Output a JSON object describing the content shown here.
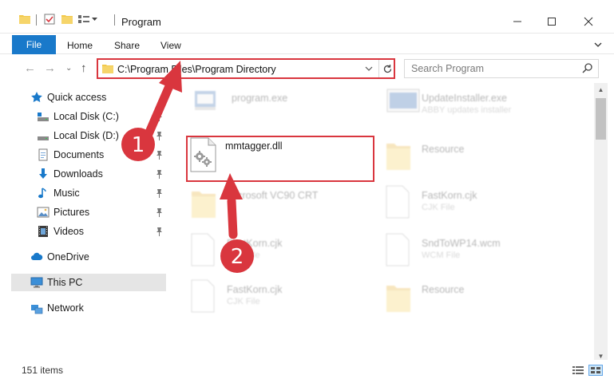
{
  "window": {
    "title": "Program",
    "minimize_icon": "minimize-icon",
    "maximize_icon": "maximize-icon",
    "close_icon": "close-icon"
  },
  "ribbon": {
    "file": "File",
    "home": "Home",
    "share": "Share",
    "view": "View"
  },
  "address": {
    "path": "C:\\Program Files\\Program Directory"
  },
  "search": {
    "placeholder": "Search Program"
  },
  "sidebar": {
    "items": [
      {
        "label": "Quick access",
        "icon": "star-icon"
      },
      {
        "label": "Local Disk (C:)",
        "icon": "drive-icon"
      },
      {
        "label": "Local Disk (D:)",
        "icon": "drive-icon"
      },
      {
        "label": "Documents",
        "icon": "documents-icon"
      },
      {
        "label": "Downloads",
        "icon": "download-icon"
      },
      {
        "label": "Music",
        "icon": "music-icon"
      },
      {
        "label": "Pictures",
        "icon": "pictures-icon"
      },
      {
        "label": "Videos",
        "icon": "videos-icon"
      },
      {
        "label": "OneDrive",
        "icon": "cloud-icon"
      },
      {
        "label": "This PC",
        "icon": "computer-icon"
      },
      {
        "label": "Network",
        "icon": "network-icon"
      }
    ]
  },
  "files": [
    {
      "name": "program.exe",
      "sub": ""
    },
    {
      "name": "UpdateInstaller.exe",
      "sub": "ABBY updates installer"
    },
    {
      "name": "mmtagger.dll",
      "sub": ""
    },
    {
      "name": "Resource",
      "sub": ""
    },
    {
      "name": "Microsoft VC90 CRT",
      "sub": ""
    },
    {
      "name": "FastKorn.cjk",
      "sub": "CJK File"
    },
    {
      "name": "FastKorn.cjk",
      "sub": "CJK File"
    },
    {
      "name": "SndToWP14.wcm",
      "sub": "WCM File"
    },
    {
      "name": "FastKorn.cjk",
      "sub": "CJK File"
    },
    {
      "name": "Resource",
      "sub": ""
    }
  ],
  "status": {
    "item_count": "151 items"
  },
  "annotations": {
    "step1": "1",
    "step2": "2",
    "color": "#d9363e"
  }
}
